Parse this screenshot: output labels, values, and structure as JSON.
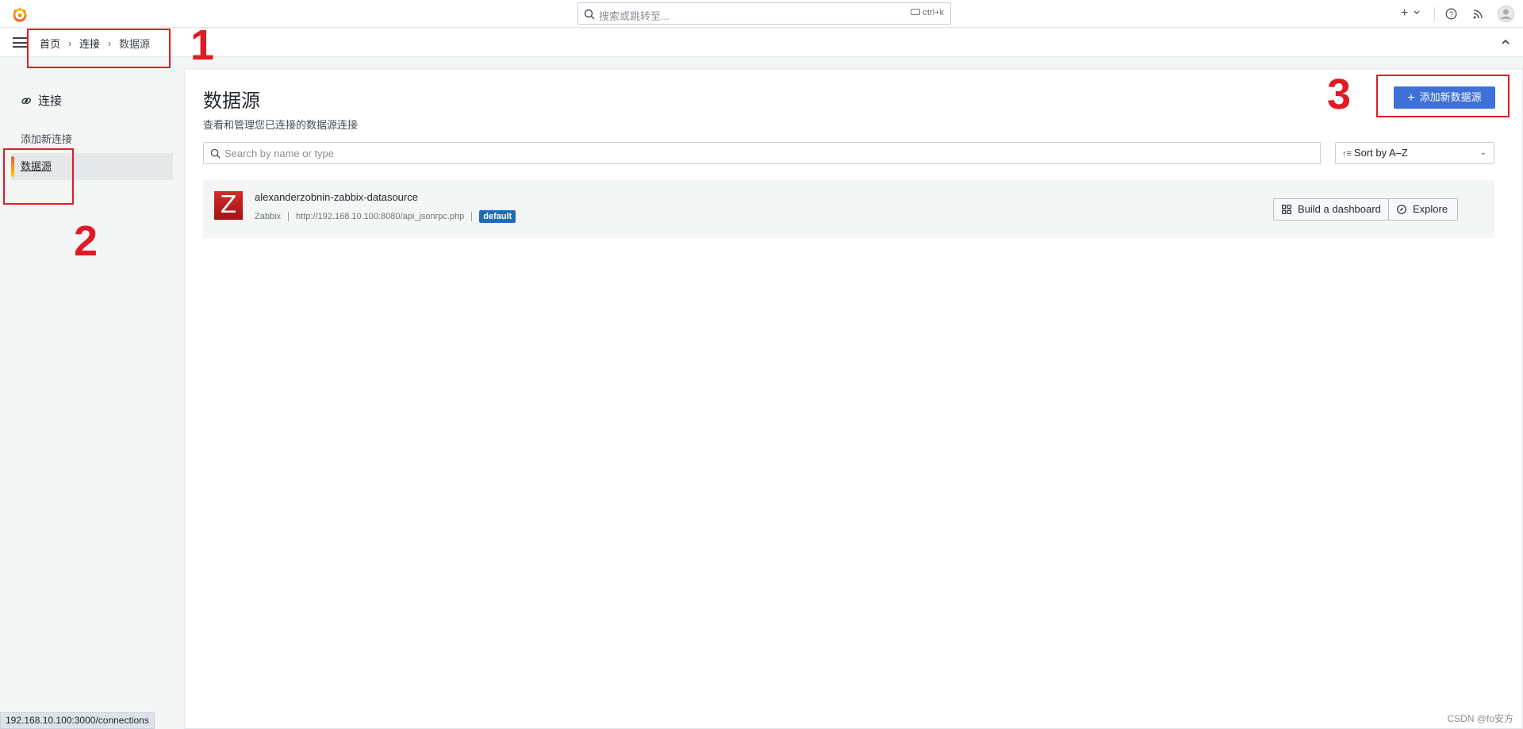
{
  "topbar": {
    "search_placeholder": "搜索或跳转至...",
    "shortcut": "ctrl+k",
    "new_label": "+"
  },
  "breadcrumb": {
    "items": [
      "首页",
      "连接",
      "数据源"
    ]
  },
  "sidebar": {
    "title": "连接",
    "items": [
      {
        "label": "添加新连接",
        "active": false
      },
      {
        "label": "数据源",
        "active": true
      }
    ]
  },
  "main": {
    "title": "数据源",
    "subtitle": "查看和管理您已连接的数据源连接",
    "add_button": "添加新数据源",
    "search_placeholder": "Search by name or type",
    "sort_label": "Sort by A–Z"
  },
  "datasources": [
    {
      "name": "alexanderzobnin-zabbix-datasource",
      "type": "Zabbix",
      "url": "http://192.168.10.100:8080/api_jsonrpc.php",
      "badge": "default",
      "logo_letter": "Z",
      "actions": [
        "Build a dashboard",
        "Explore"
      ]
    }
  ],
  "annotations": [
    "1",
    "2",
    "3"
  ],
  "status_bar": {
    "url": "192.168.10.100:3000/connections"
  },
  "watermark": "CSDN @fo安方",
  "colors": {
    "primary": "#3d71d9",
    "annotation": "#e01b24",
    "badge": "#1d6db5",
    "zabbix": "#d52b2b"
  }
}
